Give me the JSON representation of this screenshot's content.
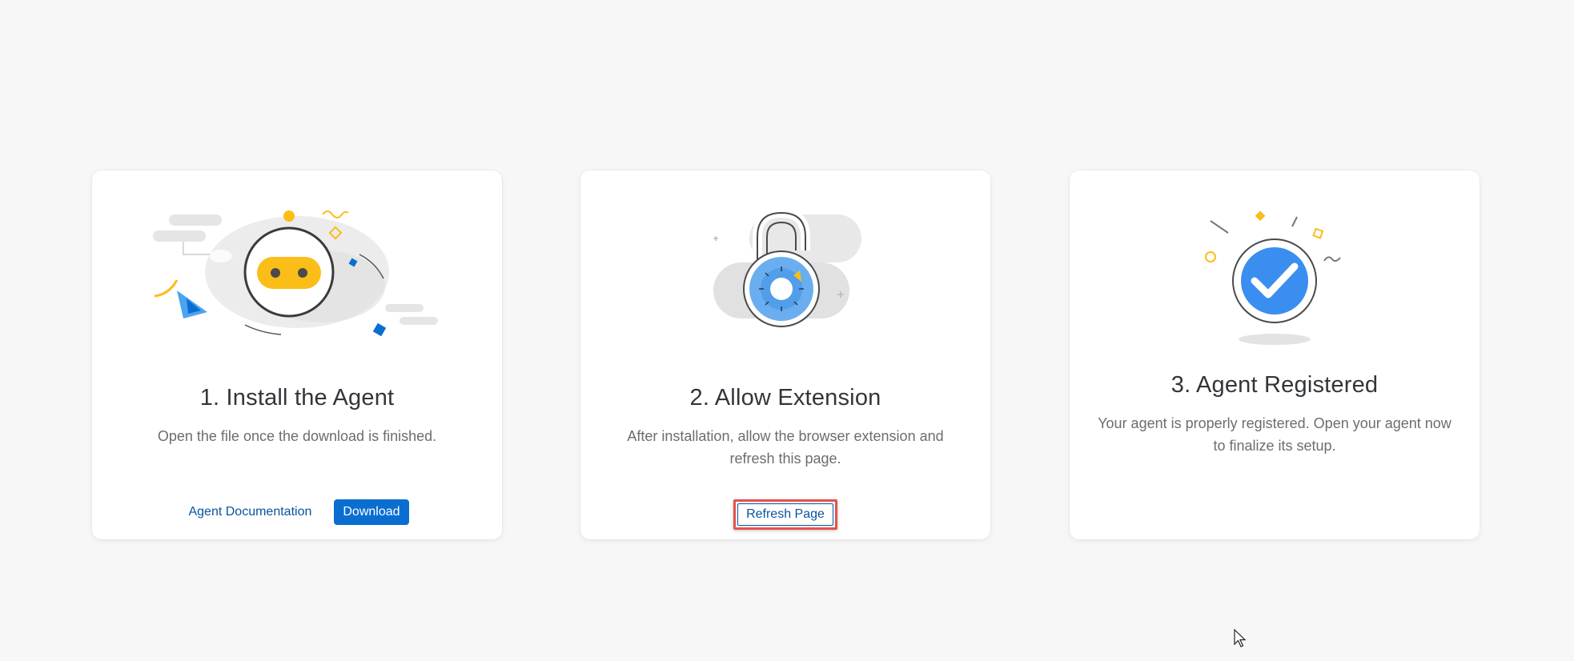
{
  "cards": [
    {
      "title": "1. Install the Agent",
      "description": "Open the file once the download is finished.",
      "illustration": "robot-agent-icon",
      "actions": {
        "documentation_label": "Agent Documentation",
        "download_label": "Download"
      }
    },
    {
      "title": "2. Allow Extension",
      "description": "After installation, allow the browser extension and refresh this page.",
      "illustration": "padlock-icon",
      "actions": {
        "refresh_label": "Refresh Page"
      }
    },
    {
      "title": "3. Agent Registered",
      "description": "Your agent is properly registered. Open your agent now to finalize its setup.",
      "illustration": "checkmark-circle-icon"
    }
  ],
  "colors": {
    "accent_blue": "#0a6ed1",
    "link_blue": "#0854a0",
    "illustration_yellow": "#fbbd18",
    "highlight_red": "#e5524b",
    "page_background": "#f7f7f7"
  }
}
